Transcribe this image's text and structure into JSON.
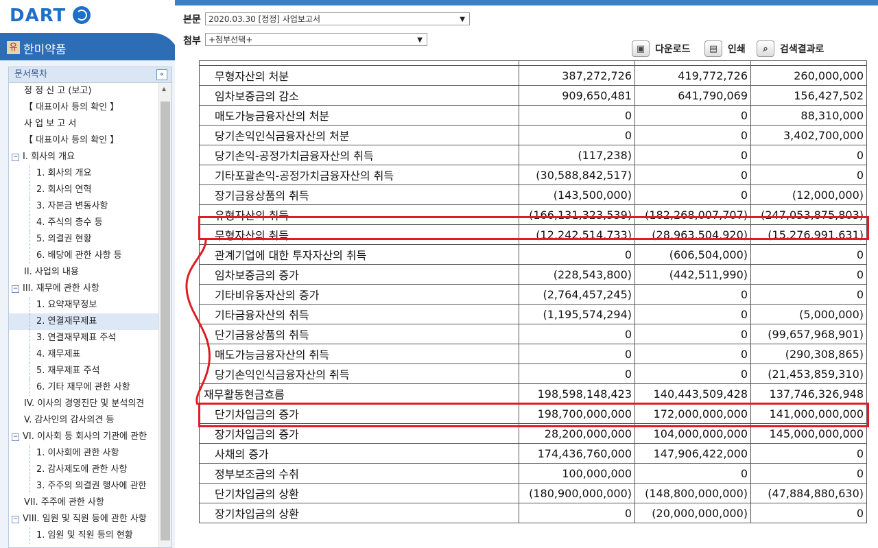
{
  "header": {
    "logo_text": "DART",
    "company_badge": "유",
    "company_name": "한미약품",
    "body_label": "본문",
    "body_select": "2020.03.30 [정정] 사업보고서",
    "attach_label": "첨부",
    "attach_select": "+첨부선택+",
    "tools": {
      "download": "다운로드",
      "print": "인쇄",
      "search_results": "검색결과로"
    }
  },
  "sidebar": {
    "title": "문서목차",
    "collapse_icon": "«",
    "items": [
      {
        "label": "정 정 신 고 (보고)",
        "level": 1
      },
      {
        "label": "【 대표이사 등의 확인 】",
        "level": 1
      },
      {
        "label": "사 업 보 고 서",
        "level": 1
      },
      {
        "label": "【 대표이사 등의 확인 】",
        "level": 1
      },
      {
        "label": "I. 회사의 개요",
        "level": 0
      },
      {
        "label": "1. 회사의 개요",
        "level": 2
      },
      {
        "label": "2. 회사의 연혁",
        "level": 2
      },
      {
        "label": "3. 자본금 변동사항",
        "level": 2
      },
      {
        "label": "4. 주식의 총수 등",
        "level": 2
      },
      {
        "label": "5. 의결권 현황",
        "level": 2
      },
      {
        "label": "6. 배당에 관한 사항 등",
        "level": 2
      },
      {
        "label": "II. 사업의 내용",
        "level": 1
      },
      {
        "label": "III. 재무에 관한 사항",
        "level": 0
      },
      {
        "label": "1. 요약재무정보",
        "level": 2
      },
      {
        "label": "2. 연결재무제표",
        "level": 2,
        "selected": true
      },
      {
        "label": "3. 연결재무제표 주석",
        "level": 2
      },
      {
        "label": "4. 재무제표",
        "level": 2
      },
      {
        "label": "5. 재무제표 주석",
        "level": 2
      },
      {
        "label": "6. 기타 재무에 관한 사항",
        "level": 2
      },
      {
        "label": "IV. 이사의 경영진단 및 분석의견",
        "level": 1
      },
      {
        "label": "V. 감사인의 감사의견 등",
        "level": 1
      },
      {
        "label": "VI. 이사회 등 회사의 기관에 관한",
        "level": 0
      },
      {
        "label": "1. 이사회에 관한 사항",
        "level": 2
      },
      {
        "label": "2. 감사제도에 관한 사항",
        "level": 2
      },
      {
        "label": "3. 주주의 의결권 행사에 관한",
        "level": 2
      },
      {
        "label": "VII. 주주에 관한 사항",
        "level": 1
      },
      {
        "label": "VIII. 임원 및 직원 등에 관한 사항",
        "level": 0
      },
      {
        "label": "1. 임원 및 직원 등의 현황",
        "level": 2
      }
    ]
  },
  "table": {
    "rows": [
      {
        "label": "무형자산의 처분",
        "v1": "387,272,726",
        "v2": "419,772,726",
        "v3": "260,000,000"
      },
      {
        "label": "임차보증금의 감소",
        "v1": "909,650,481",
        "v2": "641,790,069",
        "v3": "156,427,502"
      },
      {
        "label": "매도가능금융자산의 처분",
        "v1": "0",
        "v2": "0",
        "v3": "88,310,000"
      },
      {
        "label": "당기손익인식금융자산의 처분",
        "v1": "0",
        "v2": "0",
        "v3": "3,402,700,000"
      },
      {
        "label": "당기손익-공정가치금융자산의 취득",
        "v1": "(117,238)",
        "v2": "0",
        "v3": "0"
      },
      {
        "label": "기타포괄손익-공정가치금융자산의 취득",
        "v1": "(30,588,842,517)",
        "v2": "0",
        "v3": "0"
      },
      {
        "label": "장기금융상품의 취득",
        "v1": "(143,500,000)",
        "v2": "0",
        "v3": "(12,000,000)"
      },
      {
        "label": "유형자산의 취득",
        "v1": "(166,131,323,539)",
        "v2": "(182,268,007,707)",
        "v3": "(247,053,875,803)"
      },
      {
        "label": "무형자산의 취득",
        "v1": "(12,242,514,733)",
        "v2": "(28,963,504,920)",
        "v3": "(15,276,991,631)"
      },
      {
        "label": "관계기업에 대한 투자자산의 취득",
        "v1": "0",
        "v2": "(606,504,000)",
        "v3": "0"
      },
      {
        "label": "임차보증금의 증가",
        "v1": "(228,543,800)",
        "v2": "(442,511,990)",
        "v3": "0"
      },
      {
        "label": "기타비유동자산의 증가",
        "v1": "(2,764,457,245)",
        "v2": "0",
        "v3": "0"
      },
      {
        "label": "기타금융자산의 취득",
        "v1": "(1,195,574,294)",
        "v2": "0",
        "v3": "(5,000,000)"
      },
      {
        "label": "단기금융상품의 취득",
        "v1": "0",
        "v2": "0",
        "v3": "(99,657,968,901)"
      },
      {
        "label": "매도가능금융자산의 취득",
        "v1": "0",
        "v2": "0",
        "v3": "(290,308,865)"
      },
      {
        "label": "당기손익인식금융자산의 취득",
        "v1": "0",
        "v2": "0",
        "v3": "(21,453,859,310)"
      },
      {
        "label": "재무활동현금흐름",
        "v1": "198,598,148,423",
        "v2": "140,443,509,428",
        "v3": "137,746,326,948",
        "top": true
      },
      {
        "label": "단기차입금의 증가",
        "v1": "198,700,000,000",
        "v2": "172,000,000,000",
        "v3": "141,000,000,000"
      },
      {
        "label": "장기차입금의 증가",
        "v1": "28,200,000,000",
        "v2": "104,000,000,000",
        "v3": "145,000,000,000"
      },
      {
        "label": "사채의 증가",
        "v1": "174,436,760,000",
        "v2": "147,906,422,000",
        "v3": "0"
      },
      {
        "label": "정부보조금의 수취",
        "v1": "100,000,000",
        "v2": "0",
        "v3": "0"
      },
      {
        "label": "단기차입금의 상환",
        "v1": "(180,900,000,000)",
        "v2": "(148,800,000,000)",
        "v3": "(47,884,880,630)"
      },
      {
        "label": "장기차입금의 상환",
        "v1": "0",
        "v2": "(20,000,000,000)",
        "v3": "0"
      }
    ]
  },
  "annotation_color": "#e01b24"
}
